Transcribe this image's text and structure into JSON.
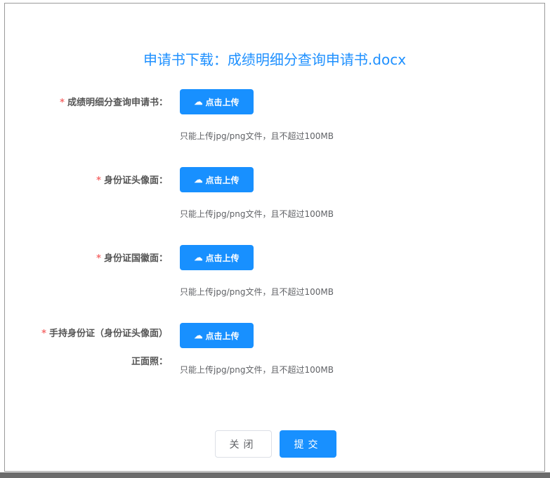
{
  "dialog": {
    "title": "申请书下载：成绩明细分查询申请书.docx"
  },
  "fields": [
    {
      "label": "成绩明细分查询申请书：",
      "button": "点击上传",
      "hint": "只能上传jpg/png文件，且不超过100MB"
    },
    {
      "label": "身份证头像面：",
      "button": "点击上传",
      "hint": "只能上传jpg/png文件，且不超过100MB"
    },
    {
      "label": "身份证国徽面：",
      "button": "点击上传",
      "hint": "只能上传jpg/png文件，且不超过100MB"
    },
    {
      "label": "手持身份证（身份证头像面）正面照：",
      "button": "点击上传",
      "hint": "只能上传jpg/png文件，且不超过100MB"
    }
  ],
  "required_mark": "*",
  "footer": {
    "close": "关闭",
    "submit": "提交"
  },
  "colors": {
    "primary": "#1890ff",
    "required": "#f56c6c"
  }
}
